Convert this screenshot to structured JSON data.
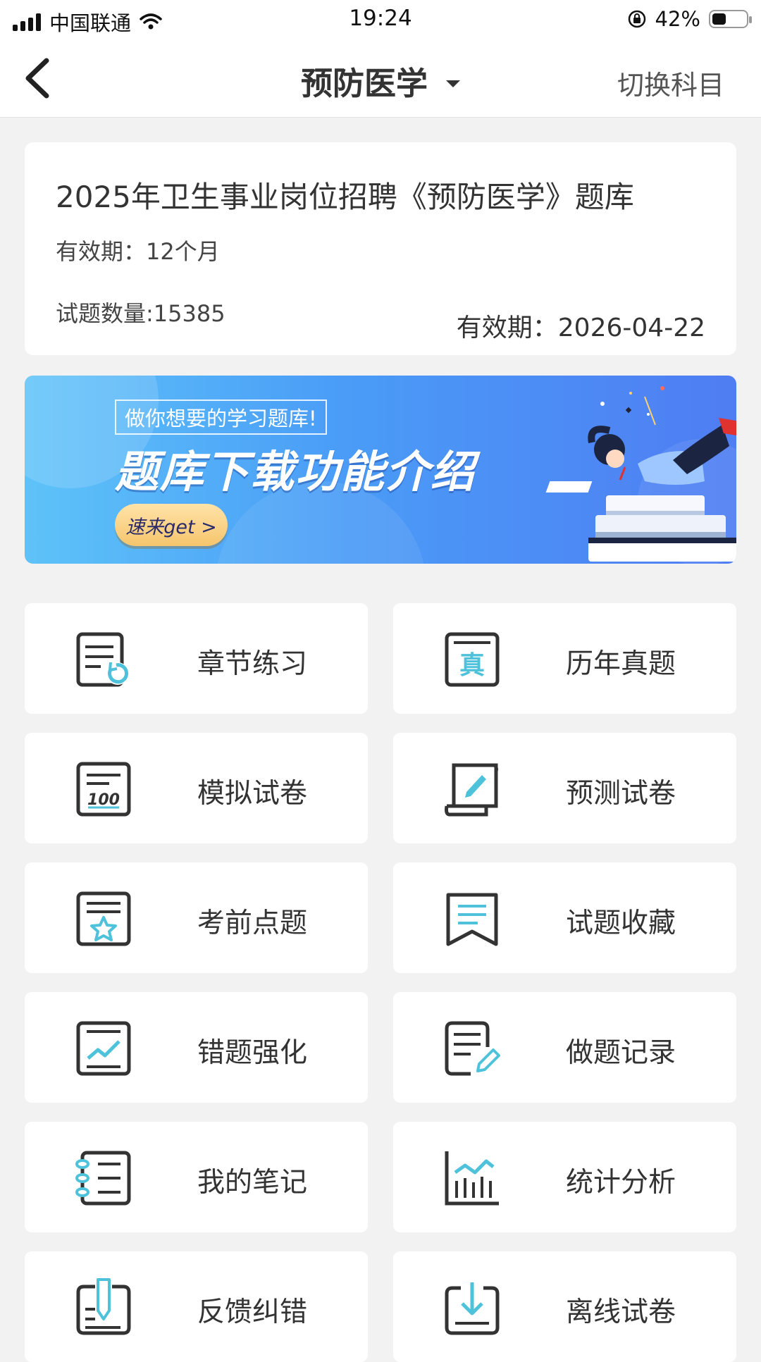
{
  "status_bar": {
    "carrier": "中国联通",
    "time": "19:24",
    "battery": "42%",
    "battery_level": 0.42
  },
  "nav": {
    "title": "预防医学",
    "switch_label": "切换科目"
  },
  "info_card": {
    "title": "2025年卫生事业岗位招聘《预防医学》题库",
    "validity": "有效期：12个月",
    "question_count": "试题数量:15385",
    "expiry": "有效期：2026-04-22"
  },
  "banner": {
    "subtitle": "做你想要的学习题库!",
    "title": "题库下载功能介绍",
    "button": "速来get >"
  },
  "menu": [
    {
      "label": "章节练习",
      "icon": "chapter-practice-icon"
    },
    {
      "label": "历年真题",
      "icon": "past-exams-icon"
    },
    {
      "label": "模拟试卷",
      "icon": "mock-exam-icon"
    },
    {
      "label": "预测试卷",
      "icon": "predict-exam-icon"
    },
    {
      "label": "考前点题",
      "icon": "pre-exam-star-icon"
    },
    {
      "label": "试题收藏",
      "icon": "bookmark-icon"
    },
    {
      "label": "错题强化",
      "icon": "wrong-questions-chart-icon"
    },
    {
      "label": "做题记录",
      "icon": "record-edit-icon"
    },
    {
      "label": "我的笔记",
      "icon": "notebook-icon"
    },
    {
      "label": "统计分析",
      "icon": "statistics-icon"
    },
    {
      "label": "反馈纠错",
      "icon": "feedback-pen-icon"
    },
    {
      "label": "离线试卷",
      "icon": "download-icon"
    }
  ],
  "colors": {
    "accent": "#4ec2da",
    "icon_dark": "#333333",
    "background": "#f2f2f2"
  }
}
